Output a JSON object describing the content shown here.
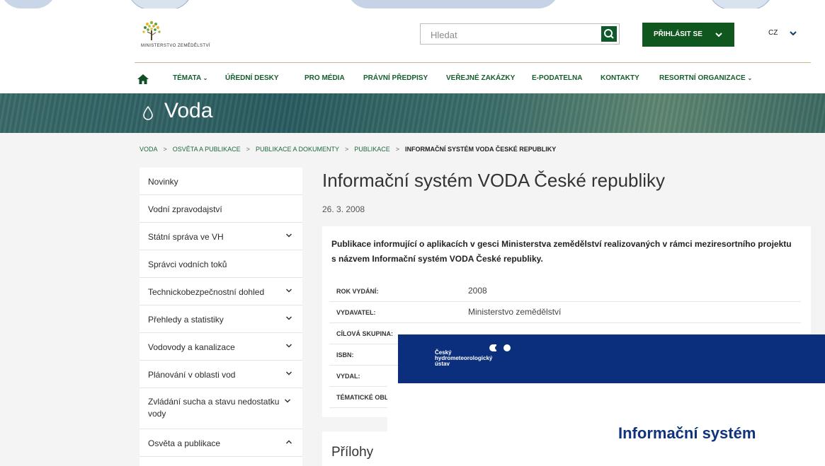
{
  "header": {
    "logo_text": "Ministerstvo zemědělství",
    "search": {
      "placeholder": "Hledat"
    },
    "login_label": "PŘIHLÁSIT SE",
    "language": "CZ"
  },
  "nav": {
    "items": [
      {
        "label": "TÉMATA",
        "has_dropdown": true
      },
      {
        "label": "ÚŘEDNÍ DESKY"
      },
      {
        "label": "PRO MÉDIA"
      },
      {
        "label": "PRÁVNÍ PŘEDPISY"
      },
      {
        "label": "VEŘEJNÉ ZAKÁZKY"
      },
      {
        "label": "E-PODATELNA"
      },
      {
        "label": "KONTAKTY"
      },
      {
        "label": "RESORTNÍ ORGANIZACE",
        "has_dropdown": true
      }
    ]
  },
  "banner": {
    "title": "Voda",
    "icon": "drop-icon"
  },
  "breadcrumb": [
    "VODA",
    "OSVĚTA A PUBLIKACE",
    "PUBLIKACE A DOKUMENTY",
    "PUBLIKACE",
    "INFORMAČNÍ SYSTÉM VODA ČESKÉ REPUBLIKY"
  ],
  "sidebar": {
    "items": [
      {
        "label": "Novinky"
      },
      {
        "label": "Vodní zpravodajství"
      },
      {
        "label": "Státní správa ve VH",
        "chevron": "down"
      },
      {
        "label": "Správci vodních toků"
      },
      {
        "label": "Technickobezpečnostní dohled",
        "chevron": "down"
      },
      {
        "label": "Přehledy a statistiky",
        "chevron": "down"
      },
      {
        "label": "Vodovody a kanalizace",
        "chevron": "down"
      },
      {
        "label": "Plánování v oblasti vod",
        "chevron": "down"
      },
      {
        "label": "Zvládání sucha a stavu nedostatku vody",
        "chevron": "down"
      },
      {
        "label": "Osvěta a publikace",
        "chevron": "up"
      }
    ]
  },
  "article": {
    "title": "Informační systém VODA České republiky",
    "date": "26. 3. 2008",
    "lead": "Publikace informující o aplikacích v gesci Ministerstva zemědělství realizovaných v rámci meziresortního projektu s názvem Informační systém VODA České republiky.",
    "meta": [
      {
        "key": "ROK VYDÁNÍ:",
        "value": "2008"
      },
      {
        "key": "VYDAVATEL:",
        "value": "Ministerstvo zemědělství"
      },
      {
        "key": "CÍLOVÁ SKUPINA:",
        "value": ""
      },
      {
        "key": "ISBN:",
        "value": ""
      },
      {
        "key": "VYDAL:",
        "value": ""
      },
      {
        "key": "TÉMATICKÉ OBLA",
        "value": ""
      }
    ],
    "attachments_title": "Přílohy"
  },
  "overlay": {
    "logo_lines": [
      "Český",
      "hydrometeorologický",
      "ústav"
    ],
    "heading": "Informační systém"
  },
  "colors": {
    "brand_green": "#155d2c",
    "login_bg": "#10561f",
    "overlay_blue": "#0b2f7c",
    "overlay_heading": "#11337d"
  }
}
